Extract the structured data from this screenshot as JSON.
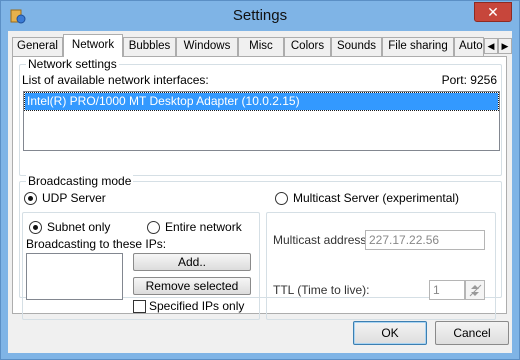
{
  "window": {
    "title": "Settings",
    "close_glyph": "✕",
    "app_icon": "settings-app-icon"
  },
  "tabs": [
    {
      "label": "General"
    },
    {
      "label": "Network",
      "active": true
    },
    {
      "label": "Bubbles"
    },
    {
      "label": "Windows"
    },
    {
      "label": "Misc"
    },
    {
      "label": "Colors"
    },
    {
      "label": "Sounds"
    },
    {
      "label": "File sharing"
    },
    {
      "label": "Auto"
    }
  ],
  "tab_scroll": {
    "left": "◀",
    "right": "▶"
  },
  "network": {
    "group_label": "Network settings",
    "list_label": "List of available network interfaces:",
    "port_label": "Port: 9256",
    "interfaces": [
      "Intel(R) PRO/1000 MT Desktop Adapter (10.0.2.15)"
    ]
  },
  "broadcast": {
    "group_label": "Broadcasting mode",
    "udp_label": "UDP Server",
    "udp_selected": true,
    "multicast_label": "Multicast Server (experimental)",
    "multicast_selected": false,
    "subnet_label": "Subnet only",
    "subnet_selected": true,
    "entire_label": "Entire network",
    "entire_selected": false,
    "ips_label": "Broadcasting to these IPs:",
    "add_label": "Add..",
    "remove_label": "Remove selected",
    "specified_label": "Specified IPs only",
    "specified_checked": false,
    "multicast_address_label": "Multicast address:",
    "multicast_address_value": "227.17.22.56",
    "ttl_label": "TTL (Time to live):",
    "ttl_value": "1"
  },
  "footer": {
    "ok_label": "OK",
    "cancel_label": "Cancel"
  },
  "colors": {
    "selection": "#3399ff",
    "title_bar": "#7fb4e6",
    "close_button": "#c7463b"
  }
}
